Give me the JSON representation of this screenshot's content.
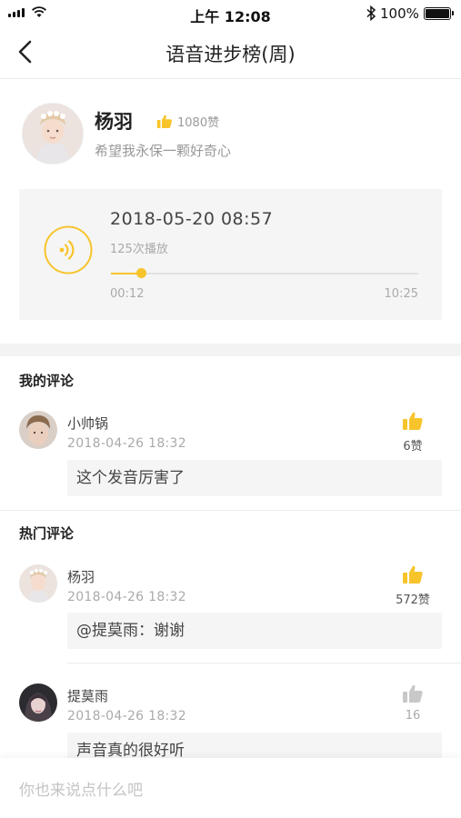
{
  "status_bar": {
    "time": "上午 12:08",
    "battery": "100%"
  },
  "nav": {
    "title": "语音进步榜(周)"
  },
  "profile": {
    "name": "杨羽",
    "likes": "1080赞",
    "bio": "希望我永保一颗好奇心"
  },
  "audio": {
    "recorded_at": "2018-05-20   08:57",
    "play_count": "125次播放",
    "current_time": "00:12",
    "total_time": "10:25",
    "progress": 0.1
  },
  "my_comments": {
    "title": "我的评论",
    "items": [
      {
        "user": "小帅锅",
        "time": "2018-04-26   18:32",
        "likes": "6赞",
        "text": "这个发音厉害了"
      }
    ]
  },
  "hot_comments": {
    "title": "热门评论",
    "items": [
      {
        "user": "杨羽",
        "time": "2018-04-26   18:32",
        "likes": "572赞",
        "text": "@提莫雨：谢谢"
      },
      {
        "user": "提莫雨",
        "time": "2018-04-26   18:32",
        "likes": "16",
        "text": "声音真的很好听"
      }
    ]
  },
  "input": {
    "placeholder": "你也来说点什么吧"
  },
  "colors": {
    "accent": "#f7c42b",
    "muted_like": "#c8c8c8"
  }
}
